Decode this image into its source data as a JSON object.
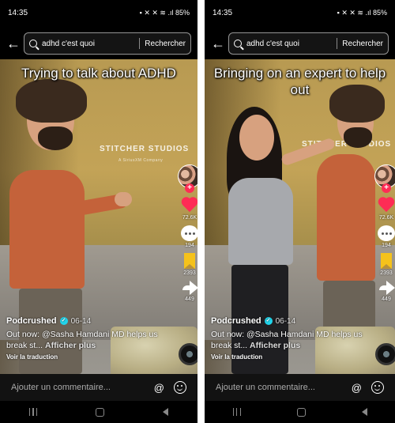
{
  "panes": [
    {
      "status": {
        "time": "14:35",
        "icons": "▪ ✕ ✕ ≋ .ıl 85%"
      },
      "search": {
        "query": "adhd c'est quoi",
        "submit_label": "Rechercher"
      },
      "caption": "Trying to talk about ADHD",
      "rail": {
        "likes": "72.6K",
        "comments": "194",
        "saves": "2393",
        "shares": "449"
      },
      "author": "Podcrushed",
      "date": "06-14",
      "description": "Out now: @Sasha Hamdani MD helps us break st...",
      "see_more": "Afficher plus",
      "translate": "Voir la traduction",
      "comment_placeholder": "Ajouter un commentaire..."
    },
    {
      "status": {
        "time": "14:35",
        "icons": "▪ ✕ ✕ ≋ .ıl 85%"
      },
      "search": {
        "query": "adhd c'est quoi",
        "submit_label": "Rechercher"
      },
      "caption": "Bringing on an expert to help out",
      "rail": {
        "likes": "72.6K",
        "comments": "194",
        "saves": "2393",
        "shares": "449"
      },
      "author": "Podcrushed",
      "date": "06-14",
      "description": "Out now: @Sasha Hamdani MD helps us break st...",
      "see_more": "Afficher plus",
      "translate": "Voir la traduction",
      "comment_placeholder": "Ajouter un commentaire..."
    }
  ],
  "scene": {
    "sign_main": "STITCHER STUDIOS",
    "sign_sub": "A SiriusXM Company"
  },
  "colors": {
    "like": "#fe2c55",
    "save": "#f5c21b",
    "verified": "#20d5ec",
    "comment_bar": "#121212"
  },
  "icons": [
    "back-arrow-icon",
    "search-icon",
    "heart-icon",
    "comment-icon",
    "bookmark-icon",
    "share-icon",
    "mention-icon",
    "emoji-icon",
    "verified-icon"
  ]
}
